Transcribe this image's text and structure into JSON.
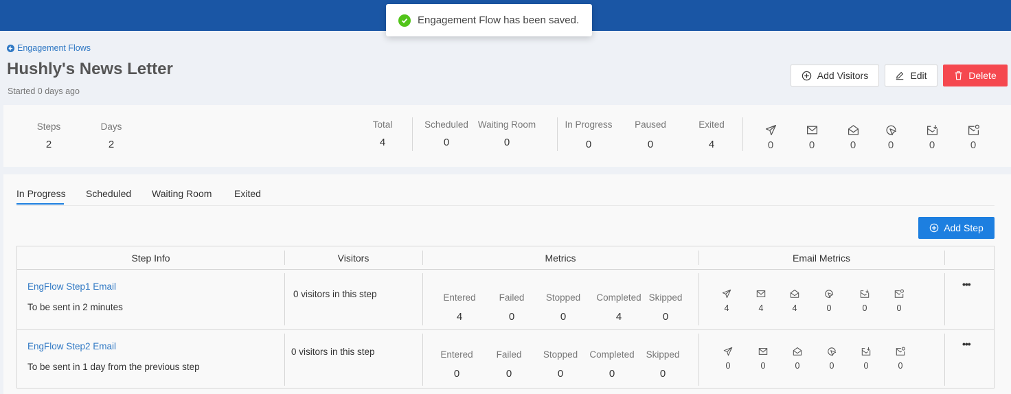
{
  "toast": {
    "message": "Engagement Flow has been saved."
  },
  "header": {
    "back_label": "Engagement Flows",
    "title": "Hushly's News Letter",
    "subtitle": "Started 0 days ago",
    "buttons": {
      "add_visitors": "Add Visitors",
      "edit": "Edit",
      "delete": "Delete"
    }
  },
  "stats": {
    "steps": {
      "label": "Steps",
      "value": "2"
    },
    "days": {
      "label": "Days",
      "value": "2"
    },
    "total": {
      "label": "Total",
      "value": "4"
    },
    "scheduled": {
      "label": "Scheduled",
      "value": "0"
    },
    "waiting_room": {
      "label": "Waiting Room",
      "value": "0"
    },
    "in_progress": {
      "label": "In Progress",
      "value": "0"
    },
    "paused": {
      "label": "Paused",
      "value": "0"
    },
    "exited": {
      "label": "Exited",
      "value": "4"
    },
    "email_metrics": [
      {
        "icon": "send-icon",
        "value": "0"
      },
      {
        "icon": "mail-icon",
        "value": "0"
      },
      {
        "icon": "mail-open-icon",
        "value": "0"
      },
      {
        "icon": "click-icon",
        "value": "0"
      },
      {
        "icon": "mail-download-icon",
        "value": "0"
      },
      {
        "icon": "mail-badge-icon",
        "value": "0"
      }
    ]
  },
  "tabs": [
    "In Progress",
    "Scheduled",
    "Waiting Room",
    "Exited"
  ],
  "add_step_label": "Add Step",
  "table": {
    "headers": [
      "Step Info",
      "Visitors",
      "Metrics",
      "Email Metrics"
    ],
    "metric_labels": [
      "Entered",
      "Failed",
      "Stopped",
      "Completed",
      "Skipped"
    ],
    "rows": [
      {
        "name": "EngFlow Step1 Email",
        "desc": "To be sent in 2 minutes",
        "visitors": "0 visitors in this step",
        "metrics": [
          "4",
          "0",
          "0",
          "4",
          "0"
        ],
        "email": [
          "4",
          "4",
          "4",
          "0",
          "0",
          "0"
        ]
      },
      {
        "name": "EngFlow Step2 Email",
        "desc": "To be sent in 1 day from the previous step",
        "visitors": "0 visitors in this step",
        "metrics": [
          "0",
          "0",
          "0",
          "0",
          "0"
        ],
        "email": [
          "0",
          "0",
          "0",
          "0",
          "0",
          "0"
        ]
      }
    ],
    "more_label": "•••"
  }
}
